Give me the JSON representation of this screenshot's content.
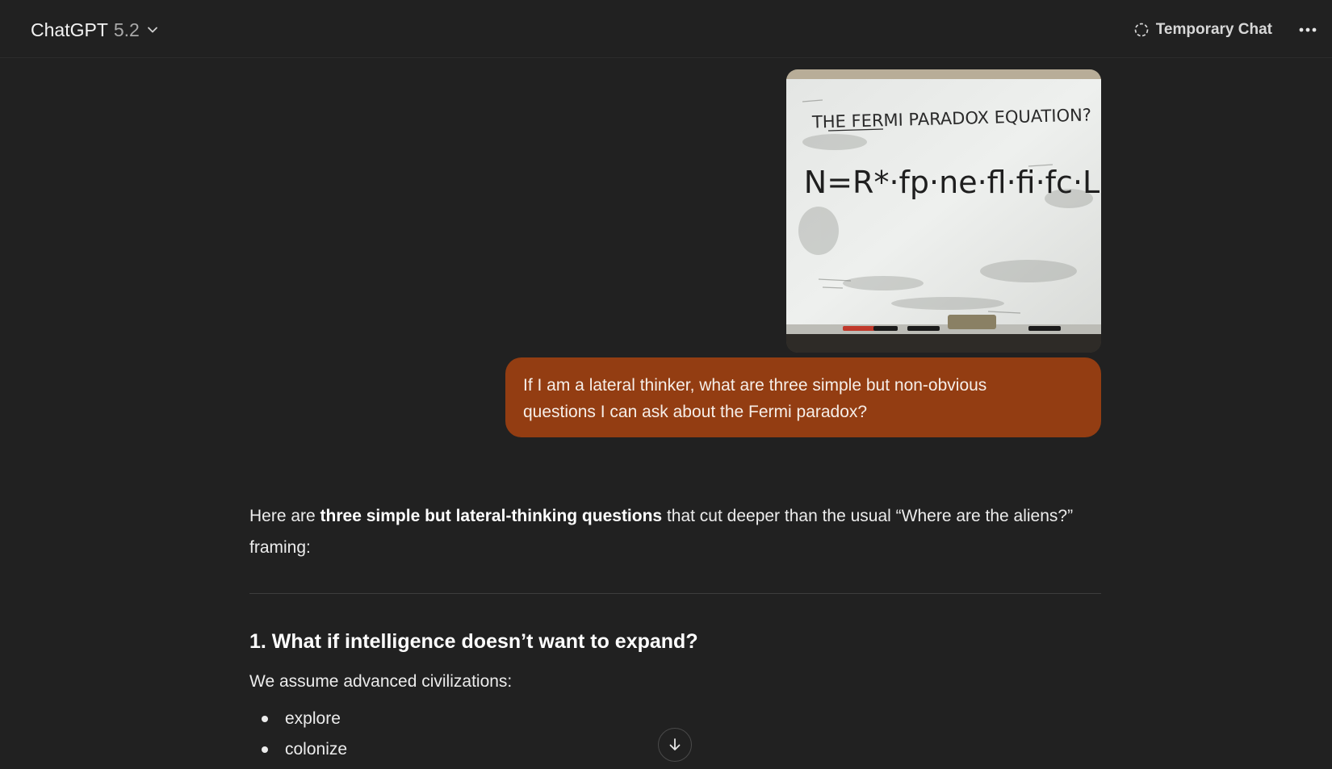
{
  "header": {
    "model_name": "ChatGPT",
    "model_version": "5.2",
    "temporary_chat_label": "Temporary Chat"
  },
  "image": {
    "title": "THE FERMI PARADOX EQUATION?",
    "equation": "N=R*·fp·ne·fl·fi·fc·L"
  },
  "user_message": {
    "line1": "If I am a lateral thinker, what are three simple but non-obvious",
    "line2": "questions I can ask about the Fermi paradox?"
  },
  "assistant": {
    "intro_prefix": "Here are ",
    "intro_bold": "three simple but lateral-thinking questions",
    "intro_suffix": " that cut deeper than the usual “Where are the aliens?” framing:",
    "q1_heading": "1. What if intelligence doesn’t want to expand?",
    "q1_text": "We assume advanced civilizations:",
    "q1_bullets": [
      "explore",
      "colonize"
    ]
  },
  "icons": {
    "model_chevron": "chevron-down-icon",
    "temporary": "dashed-circle-icon",
    "more": "ellipsis-icon",
    "scroll": "arrow-down-icon"
  }
}
